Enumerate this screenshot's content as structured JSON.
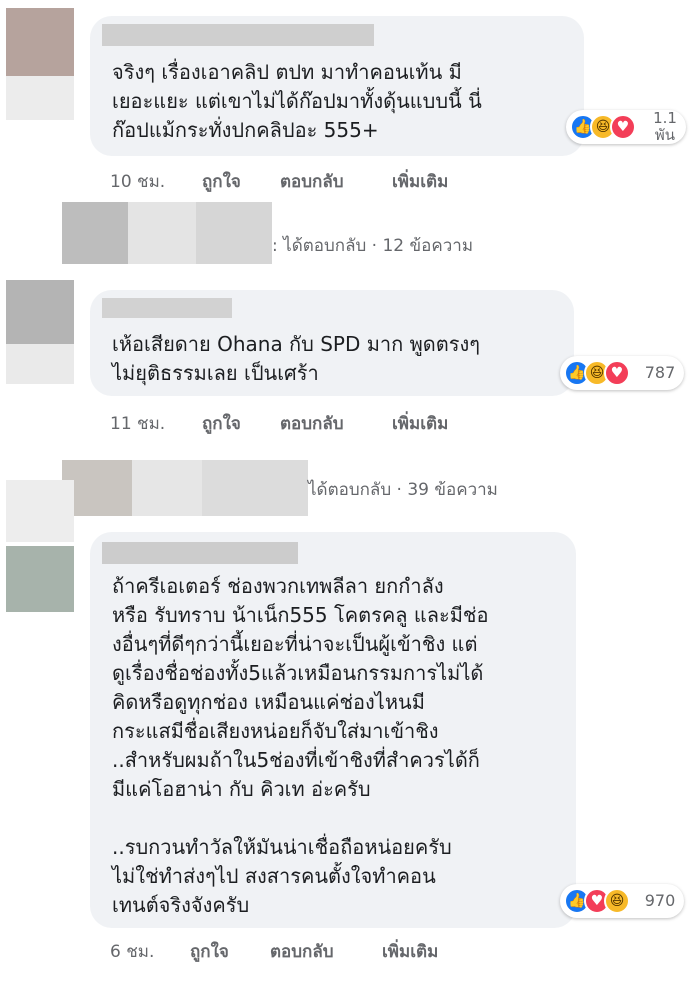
{
  "comments": [
    {
      "text_lines": [
        "จริงๆ เรื่องเอาคลิป ตปท มาทำคอนเท้น มี",
        "เยอะแยะ แต่เขาไม่ได้ก๊อปมาทั้งดุ้นแบบนี้ นี่",
        "ก๊อปแม้กระทั่งปกคลิปอะ 555+"
      ],
      "reactions": {
        "icons": [
          "like-icon",
          "haha-icon",
          "love-icon"
        ],
        "count_line1": "1.1",
        "count_line2": "พัน"
      },
      "time": "10 ชม.",
      "like_label": "ถูกใจ",
      "reply_label": "ตอบกลับ",
      "more_label": "เพิ่มเติม"
    },
    {
      "text_lines": [
        "เห้อเสียดาย Ohana กับ SPD มาก พูดตรงๆ",
        "ไม่ยุติธรรมเลย เป็นเศร้า"
      ],
      "reactions": {
        "icons": [
          "like-icon",
          "haha-icon",
          "love-icon"
        ],
        "count": "787"
      },
      "time": "11 ชม.",
      "like_label": "ถูกใจ",
      "reply_label": "ตอบกลับ",
      "more_label": "เพิ่มเติม"
    },
    {
      "text_lines": [
        "ถ้าครีเอเตอร์ ช่องพวกเทพลีลา ยกกำลัง",
        "หรือ รับทราบ น้าเน็ก555 โคตรคลู และมีช่อ",
        "งอื่นๆที่ดีๆกว่านี้เยอะที่น่าจะเป็นผู้เข้าชิง แต่",
        "ดูเรื่องชื่อช่องทั้ง5แล้วเหมือนกรรมการไม่ได้",
        "คิดหรือดูทุกช่อง เหมือนแค่ช่องไหนมี",
        "กระแสมีชื่อเสียงหน่อยก็จับใส่มาเข้าชิง",
        "..สำหรับผมถ้าใน5ช่องที่เข้าชิงที่สำควรได้ก็",
        "มีแค่โอฮาน่า กับ คิวเท อ่ะครับ",
        "",
        "..รบกวนทำวัลให้มันน่าเชื่อถือหน่อยครับ",
        "ไม่ใช่ทำส่งๆไป สงสารคนตั้งใจทำคอน",
        "เทนต์จริงจังครับ"
      ],
      "reactions": {
        "icons": [
          "like-icon",
          "love-icon",
          "haha-icon"
        ],
        "count": "970"
      },
      "time": "6 ชม.",
      "like_label": "ถูกใจ",
      "reply_label": "ตอบกลับ",
      "more_label": "เพิ่มเติม"
    }
  ],
  "replies": [
    {
      "label": "ได้ตอบกลับ · 12 ข้อความ",
      "label_prefix": ":"
    },
    {
      "label": "ได้ตอบกลับ · 39 ข้อความ"
    }
  ],
  "colors": {
    "bubble": "#f0f2f5",
    "meta_text": "#65676b",
    "like": "#1877f2",
    "haha": "#f7b928",
    "love": "#f33e58"
  }
}
